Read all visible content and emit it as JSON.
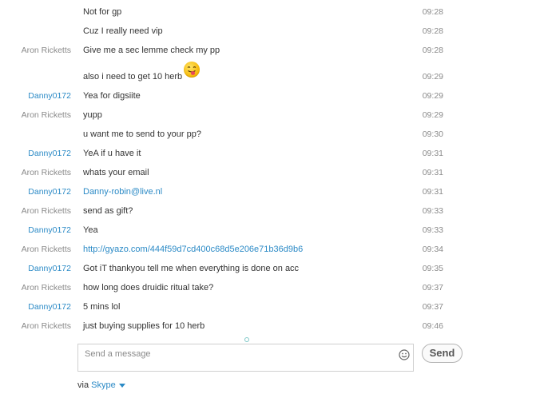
{
  "messages": [
    {
      "sender": "",
      "text": "Not for gp",
      "time": "09:28"
    },
    {
      "sender": "",
      "text": "Cuz I really need vip",
      "time": "09:28"
    },
    {
      "sender": "Aron Ricketts",
      "text": "Give me a sec lemme check my pp",
      "time": "09:28"
    },
    {
      "sender": "",
      "text": "also i need to get 10 herb",
      "time": "09:29",
      "emoji": "tongue-out-emoticon"
    },
    {
      "sender": "Danny0172",
      "text": "Yea for digsiite",
      "time": "09:29"
    },
    {
      "sender": "Aron Ricketts",
      "text": "yupp",
      "time": "09:29"
    },
    {
      "sender": "",
      "text": "u want me to send to your pp?",
      "time": "09:30"
    },
    {
      "sender": "Danny0172",
      "text": "YeA if u have it",
      "time": "09:31"
    },
    {
      "sender": "Aron Ricketts",
      "text": "whats your email",
      "time": "09:31"
    },
    {
      "sender": "Danny0172",
      "text": "Danny-robin@live.nl",
      "time": "09:31"
    },
    {
      "sender": "Aron Ricketts",
      "text": "send as gift?",
      "time": "09:33"
    },
    {
      "sender": "Danny0172",
      "text": "Yea",
      "time": "09:33"
    },
    {
      "sender": "Aron Ricketts",
      "text": "http://gyazo.com/444f59d7cd400c68d5e206e71b36d9b6",
      "time": "09:34"
    },
    {
      "sender": "Danny0172",
      "text": "Got iT thankyou tell me when everything is done on acc",
      "time": "09:35"
    },
    {
      "sender": "Aron Ricketts",
      "text": "how long does druidic ritual take?",
      "time": "09:37"
    },
    {
      "sender": "Danny0172",
      "text": "5 mins lol",
      "time": "09:37"
    },
    {
      "sender": "Aron Ricketts",
      "text": "just buying supplies for 10 herb",
      "time": "09:46"
    }
  ],
  "composer": {
    "placeholder": "Send a message",
    "send_label": "Send",
    "emoticon_icon": "smiley-icon"
  },
  "footer": {
    "via_label": "via",
    "network_label": "Skype",
    "dropdown_icon": "chevron-down-icon"
  },
  "colors": {
    "link": "#2b8ac6",
    "sender_other": "#8a8a8a",
    "text": "#333333"
  }
}
